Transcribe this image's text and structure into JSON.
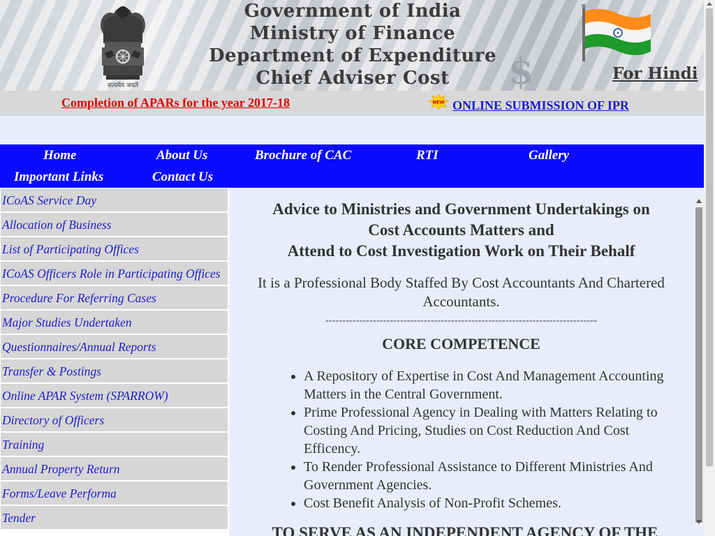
{
  "header": {
    "title_lines": [
      "Government of India",
      "Ministry of Finance",
      "Department of Expenditure",
      "Chief Adviser Cost"
    ],
    "for_hindi": "For Hindi",
    "emblem_motto": "सत्यमेव जयते"
  },
  "notice": {
    "left_link": "Completion of APARs for the year 2017-18",
    "new_badge": "NEW",
    "right_link": "ONLINE SUBMISSION OF IPR"
  },
  "nav": {
    "items": [
      "Home",
      "About Us",
      "Brochure of CAC",
      "RTI",
      "Gallery",
      "Important Links",
      "Contact Us"
    ]
  },
  "sidebar": {
    "items": [
      "ICoAS Service Day",
      "Allocation of Business",
      "List of Participating Offices",
      "ICoAS Officers Role in Participating Offices",
      "Procedure For Referring Cases",
      "Major Studies Undertaken",
      "Questionnaires/Annual Reports",
      "Transfer & Postings",
      "Online APAR System (SPARROW)",
      "Directory of Officers",
      "Training",
      "Annual Property Return",
      "Forms/Leave Performa",
      "Tender"
    ]
  },
  "main": {
    "heading_lines": [
      "Advice to Ministries and Government Undertakings on",
      "Cost Accounts Matters and",
      "Attend to Cost Investigation Work on Their Behalf"
    ],
    "subtext": "It is a Professional Body Staffed By Cost Accountants And Chartered Accountants.",
    "dashes": "--------------------------------------------------------------------------------",
    "core_title": "CORE COMPETENCE",
    "points": [
      "A Repository of Expertise in Cost And Management Accounting Matters in the Central Government.",
      "Prime Professional Agency in Dealing with Matters Relating to Costing And Pricing, Studies on Cost Reduction And Cost Efficency.",
      "To Render Professional Assistance to Different Ministries And Government Agencies.",
      "Cost Benefit Analysis of Non-Profit Schemes."
    ],
    "bottom_cut": "TO SERVE AS AN INDEPENDENT AGENCY OF THE"
  },
  "colors": {
    "nav_bg": "#0b0bff",
    "notice_red": "#e00000",
    "link_blue": "#1a1ad6",
    "content_bg": "#e9edfb",
    "sidebar_item_bg": "#d6d6d6"
  }
}
